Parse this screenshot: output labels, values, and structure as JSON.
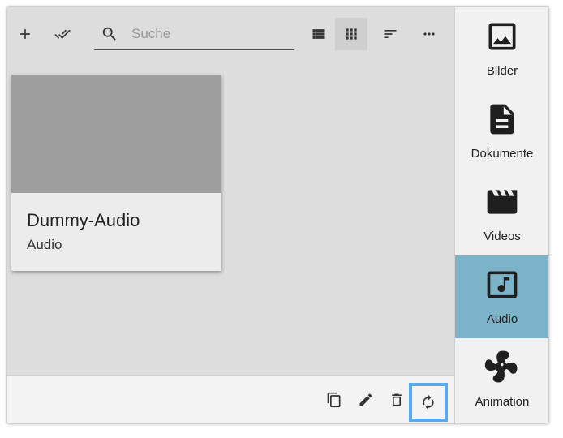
{
  "toolbar": {
    "add_icon": "plus-icon",
    "select_all_icon": "double-check-icon",
    "search": {
      "placeholder": "Suche",
      "value": ""
    },
    "view_list_icon": "list-view-icon",
    "view_grid_icon": "grid-view-icon",
    "sort_icon": "sort-icon",
    "more_icon": "more-horizontal-icon"
  },
  "card": {
    "title": "Dummy-Audio",
    "subtitle": "Audio"
  },
  "bottombar": {
    "icons": [
      "copy-icon",
      "edit-icon",
      "delete-icon",
      "replace-icon"
    ]
  },
  "sidebar": {
    "items": [
      {
        "label": "Bilder",
        "icon": "image-icon"
      },
      {
        "label": "Dokumente",
        "icon": "document-icon"
      },
      {
        "label": "Videos",
        "icon": "video-icon"
      },
      {
        "label": "Audio",
        "icon": "audio-icon",
        "active": true
      },
      {
        "label": "Animation",
        "icon": "animation-icon"
      }
    ]
  },
  "colors": {
    "active_category": "#7db3c8",
    "focus_outline": "#5aa9ec",
    "content_bg": "#dddddd"
  }
}
